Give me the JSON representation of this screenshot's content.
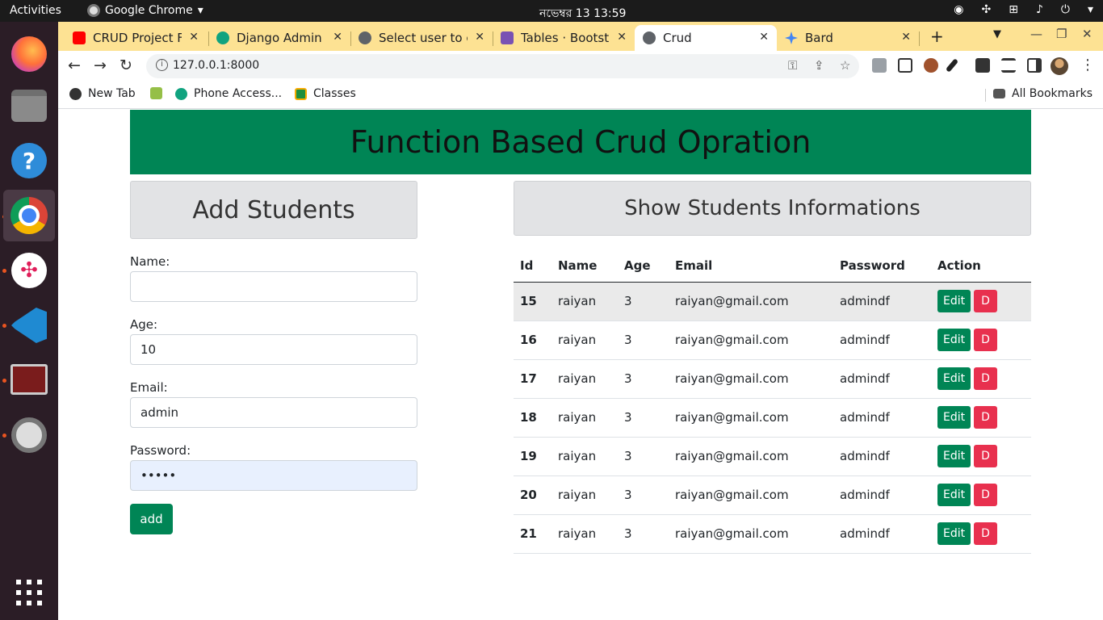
{
  "topbar": {
    "activities": "Activities",
    "app_name": "Google Chrome",
    "app_menu_arrow": "▾",
    "clock": "নভেম্বর 13  13:59"
  },
  "browser": {
    "tabs": [
      {
        "title": "CRUD Project Fu",
        "favicon_color": "#ff0000"
      },
      {
        "title": "Django Admin A",
        "favicon_color": "#10a37f"
      },
      {
        "title": "Select user to ch",
        "favicon_color": "#5f6368"
      },
      {
        "title": "Tables · Bootstr",
        "favicon_color": "#7952b3"
      },
      {
        "title": "Crud",
        "favicon_color": "#5f6368"
      },
      {
        "title": "Bard",
        "favicon_color": "#4285f4"
      }
    ],
    "url": "127.0.0.1:8000",
    "bookmarks": [
      {
        "label": "New Tab"
      },
      {
        "label": ""
      },
      {
        "label": "Phone Access..."
      },
      {
        "label": "Classes"
      }
    ],
    "all_bookmarks": "All Bookmarks"
  },
  "page": {
    "title": "Function Based Crud Opration",
    "form": {
      "heading": "Add Students",
      "name_label": "Name:",
      "name_value": "",
      "age_label": "Age:",
      "age_value": "10",
      "email_label": "Email:",
      "email_value": "admin",
      "password_label": "Password:",
      "password_value": "•••••",
      "submit_label": "add"
    },
    "list": {
      "heading": "Show Students Informations",
      "columns": [
        "Id",
        "Name",
        "Age",
        "Email",
        "Password",
        "Action"
      ],
      "rows": [
        {
          "id": "15",
          "name": "raiyan",
          "age": "3",
          "email": "raiyan@gmail.com",
          "password": "admindf",
          "edit": "Edit",
          "delete": "D"
        },
        {
          "id": "16",
          "name": "raiyan",
          "age": "3",
          "email": "raiyan@gmail.com",
          "password": "admindf",
          "edit": "Edit",
          "delete": "D"
        },
        {
          "id": "17",
          "name": "raiyan",
          "age": "3",
          "email": "raiyan@gmail.com",
          "password": "admindf",
          "edit": "Edit",
          "delete": "D"
        },
        {
          "id": "18",
          "name": "raiyan",
          "age": "3",
          "email": "raiyan@gmail.com",
          "password": "admindf",
          "edit": "Edit",
          "delete": "D"
        },
        {
          "id": "19",
          "name": "raiyan",
          "age": "3",
          "email": "raiyan@gmail.com",
          "password": "admindf",
          "edit": "Edit",
          "delete": "D"
        },
        {
          "id": "20",
          "name": "raiyan",
          "age": "3",
          "email": "raiyan@gmail.com",
          "password": "admindf",
          "edit": "Edit",
          "delete": "D"
        },
        {
          "id": "21",
          "name": "raiyan",
          "age": "3",
          "email": "raiyan@gmail.com",
          "password": "admindf",
          "edit": "Edit",
          "delete": "D"
        }
      ]
    }
  },
  "colors": {
    "primary_green": "#008555",
    "danger_red": "#e8304e",
    "tab_strip": "#fde293"
  }
}
